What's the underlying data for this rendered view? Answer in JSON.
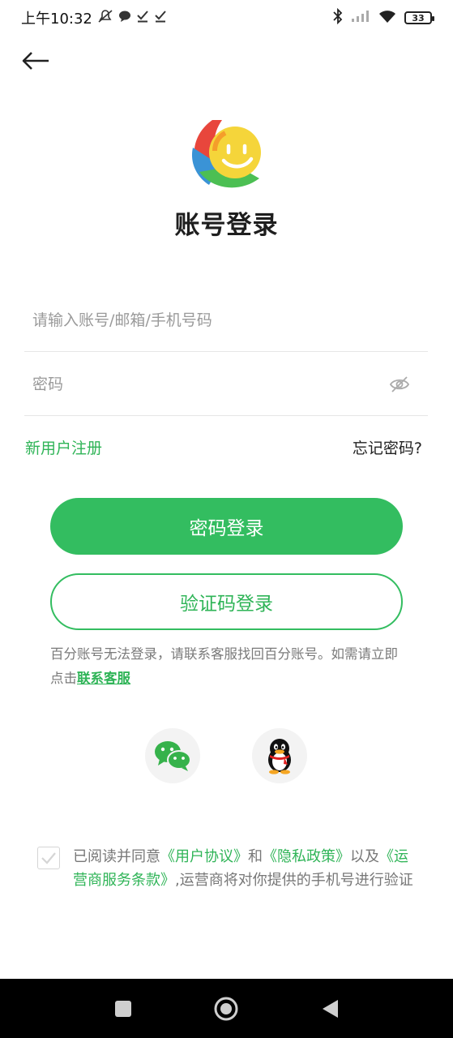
{
  "status_bar": {
    "time": "上午10:32",
    "battery": "33"
  },
  "header": {
    "title": "账号登录"
  },
  "form": {
    "account_placeholder": "请输入账号/邮箱/手机号码",
    "password_placeholder": "密码"
  },
  "links": {
    "register": "新用户注册",
    "forgot": "忘记密码?"
  },
  "buttons": {
    "password_login": "密码登录",
    "code_login": "验证码登录"
  },
  "help": {
    "text": "百分账号无法登录，请联系客服找回百分账号。如需请立即点击",
    "link": "联系客服"
  },
  "social": {
    "wechat_icon": "wechat-icon",
    "qq_icon": "qq-icon"
  },
  "agreement": {
    "prefix": "已阅读并同意",
    "user_agreement": "《用户协议》",
    "and": "和",
    "privacy_policy": "《隐私政策》",
    "also": "以及",
    "carrier_terms": "《运营商服务条款》",
    "suffix": ",运营商将对你提供的手机号进行验证",
    "checked": true
  },
  "colors": {
    "accent": "#33bd60",
    "link": "#2fb457"
  }
}
